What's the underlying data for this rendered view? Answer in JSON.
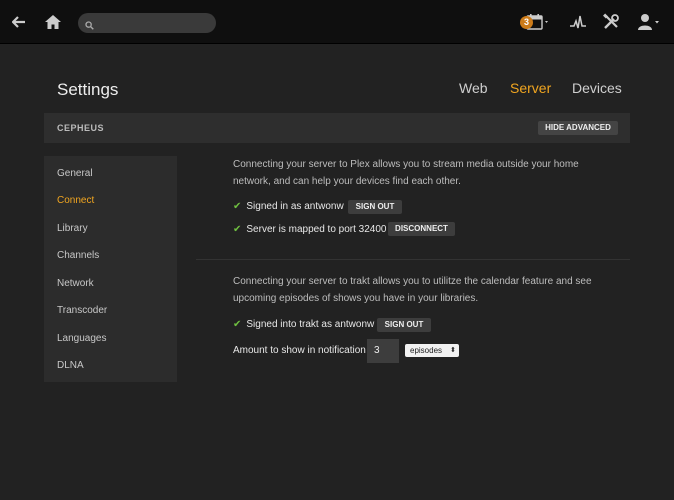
{
  "topbar": {
    "back_icon": "back-arrow-icon",
    "home_icon": "home-icon",
    "search_placeholder": "",
    "calendar_badge": "3",
    "icons": [
      "calendar-icon",
      "activity-icon",
      "tools-icon",
      "user-icon"
    ]
  },
  "header": {
    "title": "Settings",
    "tabs": [
      "Web",
      "Server",
      "Devices"
    ],
    "active_tab": "Server"
  },
  "server": {
    "name": "CEPHEUS",
    "hide_advanced_label": "HIDE ADVANCED"
  },
  "sidebar": {
    "items": [
      "General",
      "Connect",
      "Library",
      "Channels",
      "Network",
      "Transcoder",
      "Languages",
      "DLNA"
    ],
    "active": "Connect"
  },
  "connect": {
    "description": "Connecting your server to Plex allows you to stream media outside your home network, and can help your devices find each other.",
    "signed_in_text": "Signed in as antwonw",
    "sign_out_label": "SIGN OUT",
    "port_text": "Server is mapped to port 32400",
    "disconnect_label": "DISCONNECT"
  },
  "trakt": {
    "description": "Connecting your server to trakt allows you to utilitze the calendar feature and see upcoming episodes of shows you have in your libraries.",
    "signed_in_text": "Signed into trakt as antwonw",
    "sign_out_label": "SIGN OUT",
    "amount_label": "Amount to show in notification",
    "amount_value": "3",
    "unit_selected": "episodes"
  },
  "colors": {
    "accent": "#f0a520",
    "check": "#6fbf40",
    "badge": "#cc7b19"
  }
}
